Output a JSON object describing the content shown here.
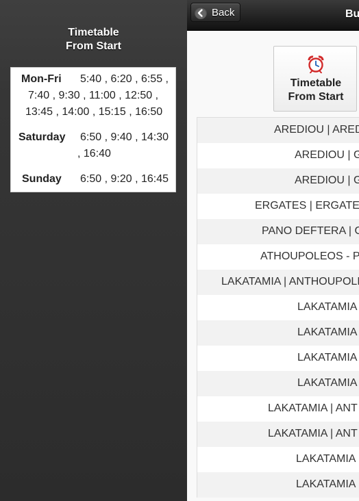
{
  "left_panel": {
    "title_line1": "Timetable",
    "title_line2": "From Start",
    "schedule": {
      "weekdays": {
        "label": "Mon-Fri",
        "line1": "5:40 , 6:20 , 6:55 ,",
        "line2": "7:40 , 9:30 , 11:00 , 12:50 ,",
        "line3": "13:45 , 14:00 , 15:15 , 16:50"
      },
      "saturday": {
        "label": "Saturday",
        "line1": "6:50 , 9:40 , 14:30",
        "line2": ", 16:40"
      },
      "sunday": {
        "label": "Sunday",
        "line1": "6:50 , 9:20 , 16:45"
      }
    }
  },
  "header": {
    "back_label": "Back",
    "title": "Bu"
  },
  "main": {
    "timetable_button": {
      "line1": "Timetable",
      "line2": "From Start"
    },
    "routes": [
      "AREDIOU | AREDI",
      "AREDIOU | G",
      "AREDIOU | G",
      "ERGATES | ERGATE",
      "PANO DEFTERA | G",
      "ATHOUPOLEOS - P",
      "LAKATAMIA | ANTHOUPOLI",
      "LAKATAMIA",
      "LAKATAMIA",
      "LAKATAMIA",
      "LAKATAMIA",
      "LAKATAMIA | ANT",
      "LAKATAMIA | ANT",
      "LAKATAMIA",
      "LAKATAMIA"
    ]
  },
  "icons": {
    "back": "arrow-left-circle-icon",
    "timetable": "alarm-clock-icon"
  },
  "colors": {
    "accent": "#d22b2b",
    "clock_blue": "#2f6fbf"
  }
}
